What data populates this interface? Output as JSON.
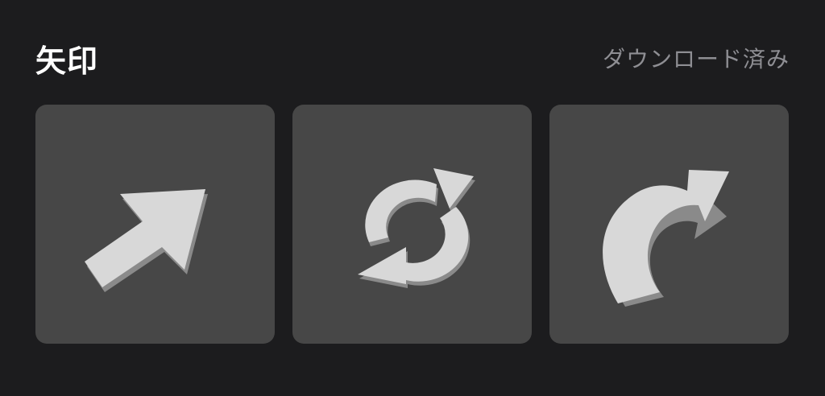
{
  "header": {
    "title": "矢印",
    "status": "ダウンロード済み"
  },
  "tiles": [
    {
      "icon": "diagonal-arrow-icon"
    },
    {
      "icon": "refresh-cycle-icon"
    },
    {
      "icon": "curved-arrow-icon"
    }
  ],
  "colors": {
    "background": "#1c1c1e",
    "tile": "#474747",
    "icon": "#d8d8d8",
    "icon_shadow": "#8a8a8a",
    "title": "#ffffff",
    "status": "#8e8e93"
  }
}
